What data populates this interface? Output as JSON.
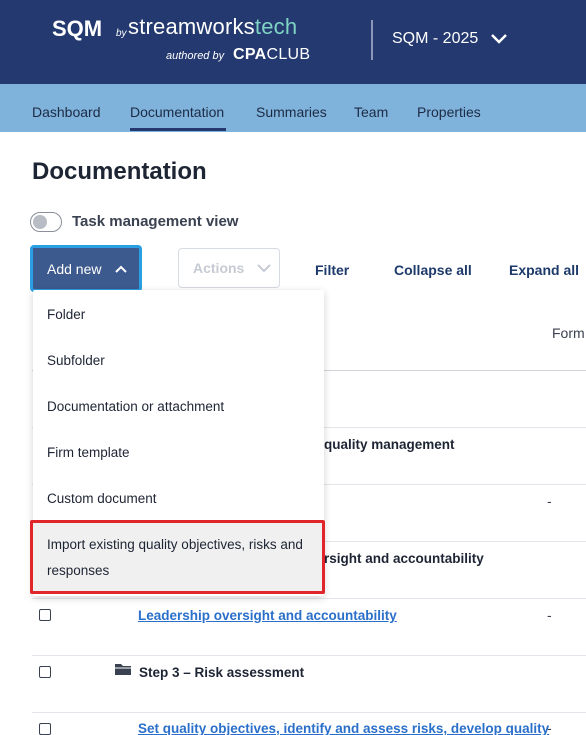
{
  "header": {
    "product": "SQM",
    "by": "by",
    "brand_streamworks": "streamworks",
    "brand_tech": "tech",
    "authored_by": "authored by",
    "cpa": "CPA",
    "club": "CLUB",
    "year_select": "SQM - 2025",
    "colors": {
      "bar": "#24396f",
      "tech_accent": "#7fd3c4"
    }
  },
  "nav": {
    "items": [
      "Dashboard",
      "Documentation",
      "Summaries",
      "Team",
      "Properties"
    ],
    "active": "Documentation",
    "color": "#7fb3dc"
  },
  "page": {
    "title": "Documentation",
    "toggle_label": "Task management view",
    "toggle_on": false
  },
  "toolbar": {
    "add_new": "Add new",
    "actions": "Actions",
    "filter": "Filter",
    "collapse_all": "Collapse all",
    "expand_all": "Expand all"
  },
  "dropdown": {
    "items": [
      "Folder",
      "Subfolder",
      "Documentation or attachment",
      "Firm template",
      "Custom document"
    ],
    "highlighted": "Import existing quality objectives, risks and responses"
  },
  "table": {
    "column_header": "Form",
    "rows": [
      {
        "text": "quality management",
        "dash": ""
      },
      {
        "text": "",
        "dash": "-"
      },
      {
        "text": "rsight and accountability",
        "dash": ""
      },
      {
        "text": "Leadership oversight and accountability",
        "dash": "-",
        "link": true
      },
      {
        "text": "Step 3 – Risk assessment",
        "dash": ""
      },
      {
        "text": "Set quality objectives, identify and assess risks, develop quality",
        "dash": "-",
        "link": true
      }
    ]
  }
}
